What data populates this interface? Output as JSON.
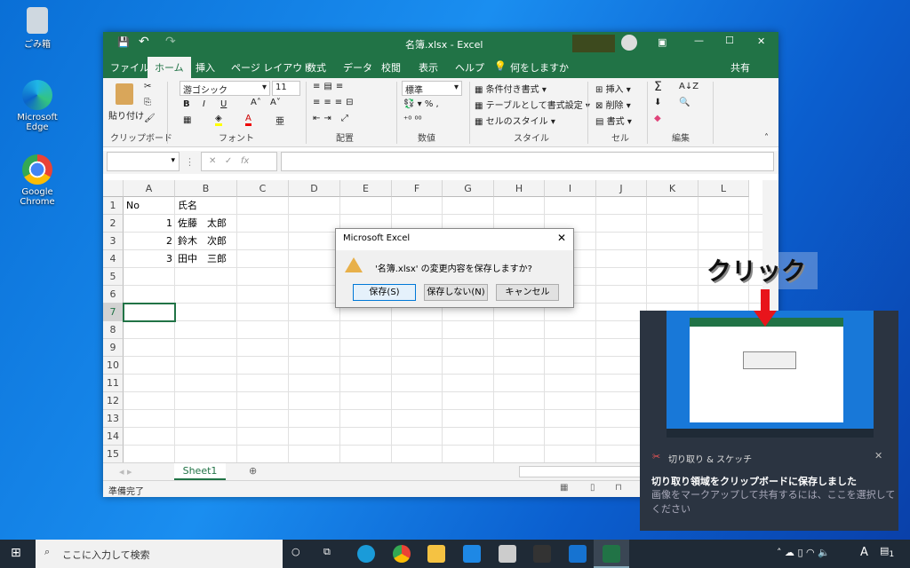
{
  "desktop": {
    "icons": [
      {
        "label": "ごみ箱"
      },
      {
        "label": "Microsoft Edge"
      },
      {
        "label": "Google Chrome"
      }
    ]
  },
  "excel": {
    "title": "名簿.xlsx  -  Excel",
    "tabs": [
      "ファイル",
      "ホーム",
      "挿入",
      "ページ レイアウト",
      "数式",
      "データ",
      "校閲",
      "表示",
      "ヘルプ"
    ],
    "tell_me": "何をしますか",
    "share": "共有",
    "ribbon": {
      "paste": "貼り付け",
      "font_name": "游ゴシック",
      "font_size": "11",
      "number_format": "標準",
      "conditional": "条件付き書式",
      "table": "テーブルとして書式設定",
      "cell_style": "セルのスタイル",
      "insert": "挿入",
      "delete": "削除",
      "format": "書式",
      "groups": [
        "クリップボード",
        "フォント",
        "配置",
        "数値",
        "スタイル",
        "セル",
        "編集"
      ]
    },
    "formula_label": "fx",
    "columns": [
      "A",
      "B",
      "C",
      "D",
      "E",
      "F",
      "G",
      "H",
      "I",
      "J",
      "K",
      "L"
    ],
    "rows": [
      "1",
      "2",
      "3",
      "4",
      "5",
      "6",
      "7",
      "8",
      "9",
      "10",
      "11",
      "12",
      "13",
      "14",
      "15"
    ],
    "cells": {
      "A1": "No",
      "B1": "氏名",
      "A2": "1",
      "B2": "佐藤　太郎",
      "A3": "2",
      "B3": "鈴木　次郎",
      "A4": "3",
      "B4": "田中　三郎"
    },
    "sheet_tab": "Sheet1",
    "status": "準備完了",
    "accent": "#217346"
  },
  "dialog": {
    "title": "Microsoft Excel",
    "message": "'名簿.xlsx' の変更内容を保存しますか?",
    "save": "保存(S)",
    "dont_save": "保存しない(N)",
    "cancel": "キャンセル"
  },
  "annotation": {
    "label": "クリック",
    "arrow_color": "#e8141b"
  },
  "toast": {
    "app": "切り取り & スケッチ",
    "title": "切り取り領域をクリップボードに保存しました",
    "body": "画像をマークアップして共有するには、ここを選択してください"
  },
  "taskbar": {
    "search_placeholder": "ここに入力して検索",
    "ime": "A",
    "notifications": "1"
  }
}
